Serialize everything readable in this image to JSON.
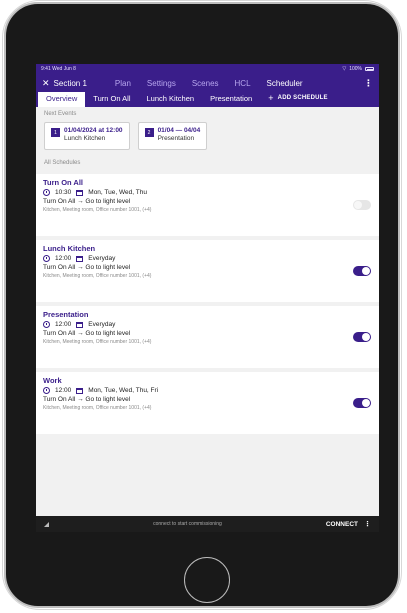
{
  "status": {
    "time": "9:41  Wed Jun 8",
    "battery": "100%"
  },
  "header": {
    "close_glyph": "✕",
    "title": "Section 1",
    "tabs": [
      {
        "label": "Plan"
      },
      {
        "label": "Settings"
      },
      {
        "label": "Scenes"
      },
      {
        "label": "HCL"
      },
      {
        "label": "Scheduler"
      }
    ],
    "menu_glyph": "⋮"
  },
  "subtabs": [
    {
      "label": "Overview"
    },
    {
      "label": "Turn On All"
    },
    {
      "label": "Lunch Kitchen"
    },
    {
      "label": "Presentation"
    }
  ],
  "add_schedule": {
    "plus": "+",
    "label": "ADD SCHEDULE"
  },
  "next_events": {
    "label": "Next Events",
    "items": [
      {
        "num": "1",
        "main": "01/04/2024 at 12:00",
        "sub": "Lunch Kitchen"
      },
      {
        "num": "2",
        "main": "01/04 — 04/04",
        "sub": "Presentation"
      }
    ]
  },
  "all_schedules_label": "All Schedules",
  "schedules": [
    {
      "name": "Turn On All",
      "time": "10:30",
      "days": "Mon, Tue, Wed, Thu",
      "action": "Turn On All → Go to light level",
      "rooms": "Kitchen, Meeting room, Office number 1001, (+4)",
      "enabled": false
    },
    {
      "name": "Lunch Kitchen",
      "time": "12:00",
      "days": "Everyday",
      "action": "Turn On All → Go to light level",
      "rooms": "Kitchen, Meeting room, Office number 1001, (+4)",
      "enabled": true
    },
    {
      "name": "Presentation",
      "time": "12:00",
      "days": "Everyday",
      "action": "Turn On All → Go to light level",
      "rooms": "Kitchen, Meeting room, Office number 1001, (+4)",
      "enabled": true
    },
    {
      "name": "Work",
      "time": "12:00",
      "days": "Mon, Tue, Wed, Thu, Fri",
      "action": "Turn On All → Go to light level",
      "rooms": "Kitchen, Meeting room, Office number 1001, (+4)",
      "enabled": true
    }
  ],
  "bottom": {
    "hint": "connect to start commissioning",
    "connect": "CONNECT",
    "menu_glyph": "⋮"
  },
  "colors": {
    "primary": "#3a1e8a",
    "background": "#f1f1f1"
  }
}
